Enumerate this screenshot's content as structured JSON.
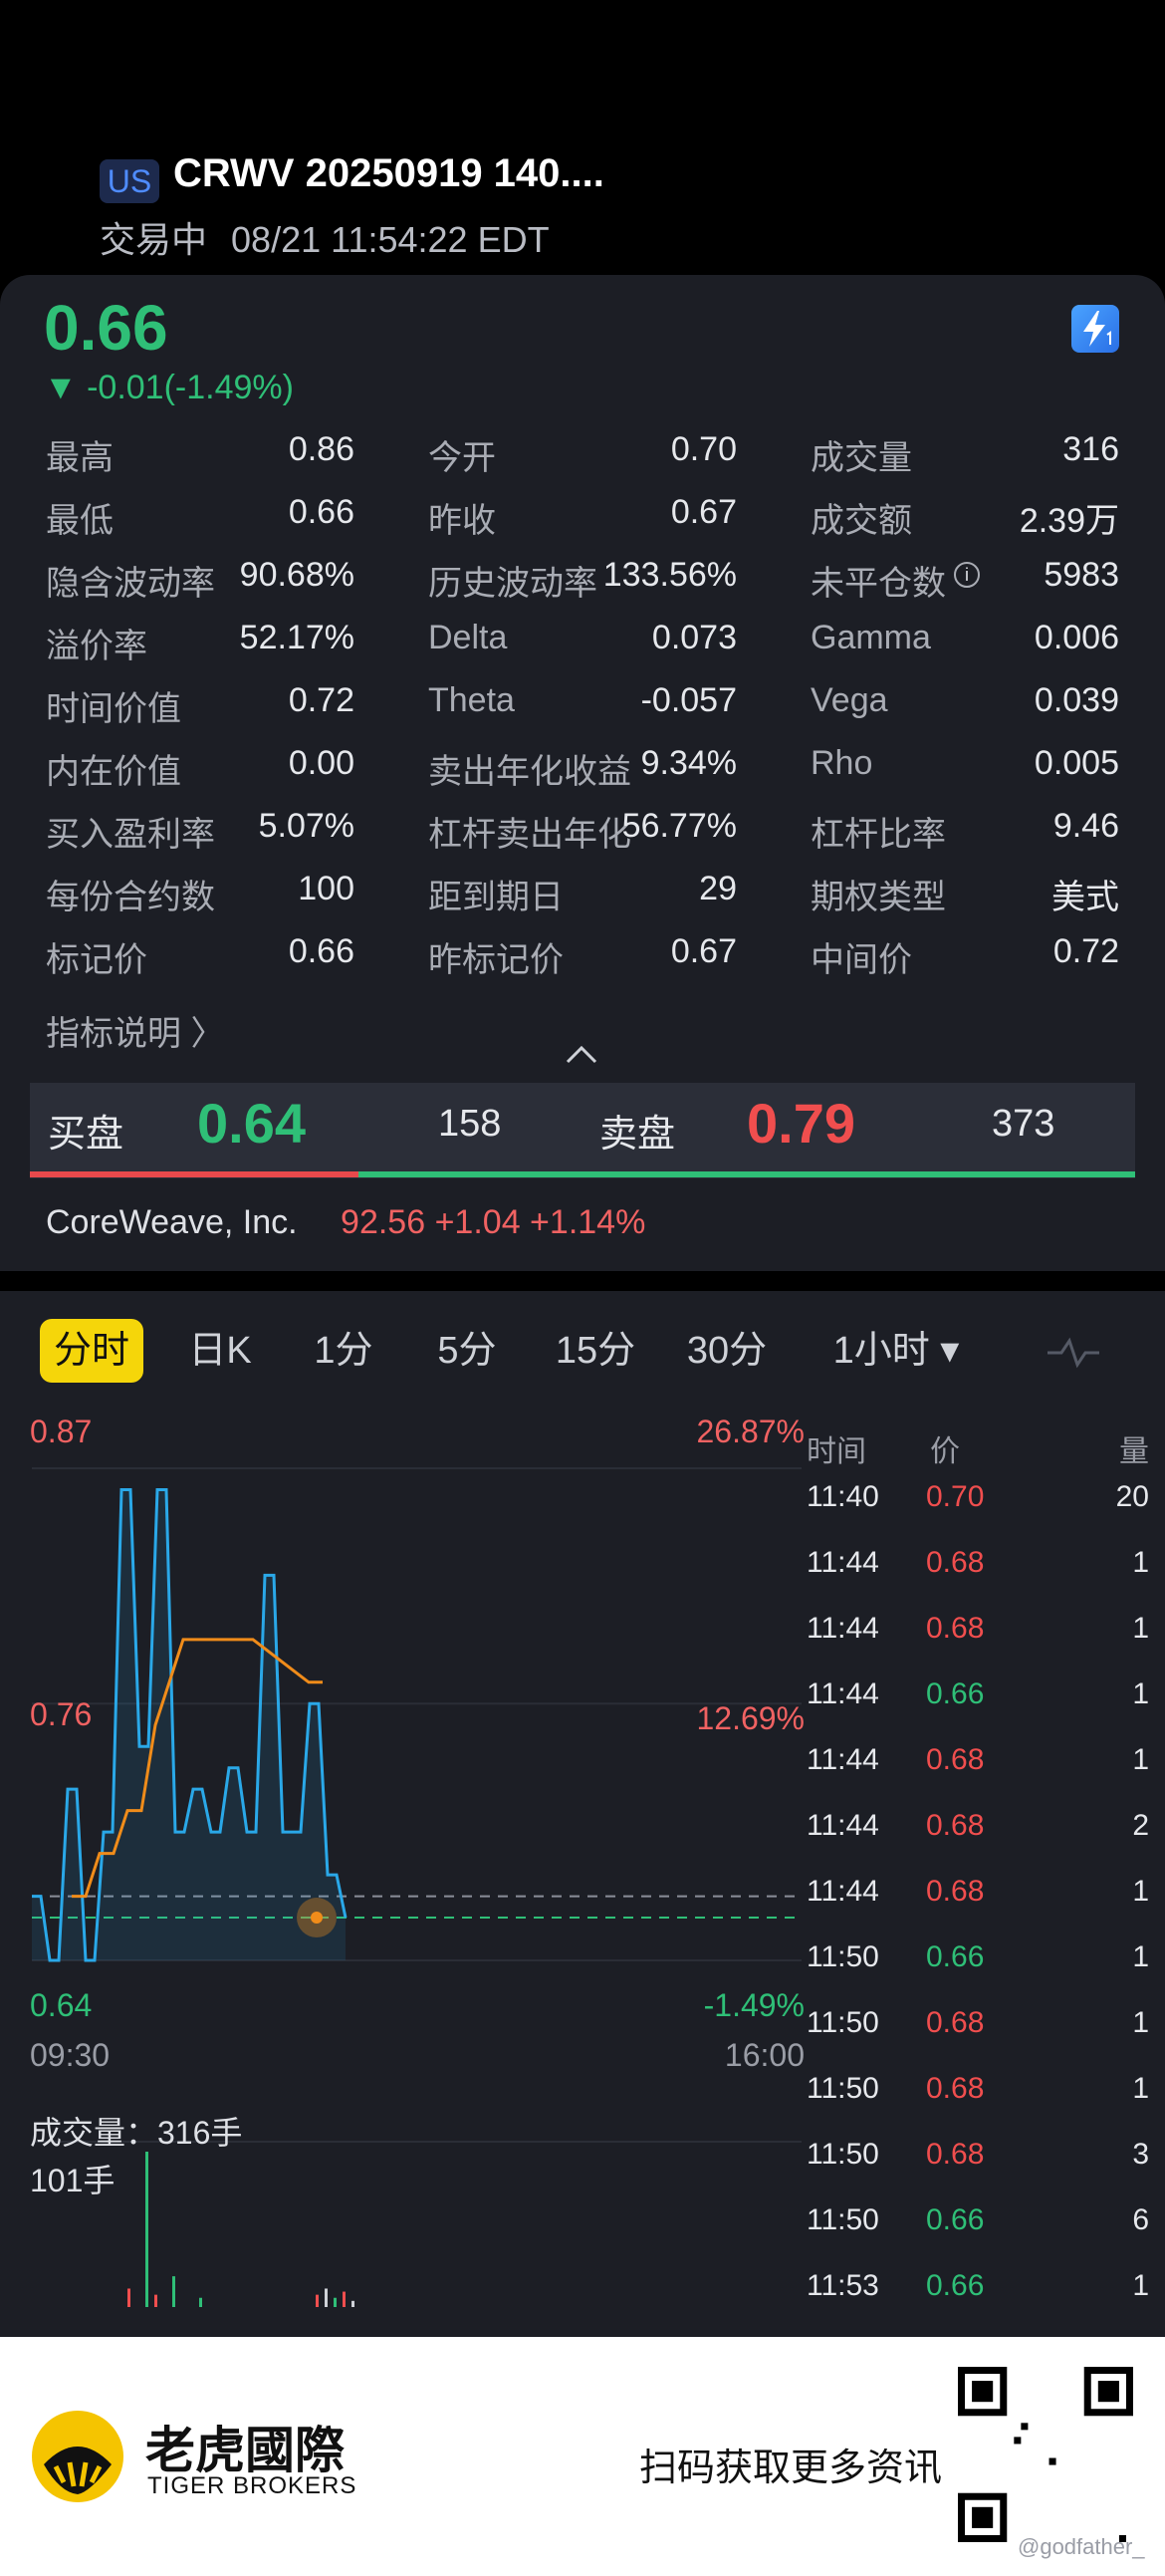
{
  "header": {
    "market_badge": "US",
    "title": "CRWV 20250919 140....",
    "status": "交易中",
    "datetime": "08/21 11:54:22 EDT"
  },
  "quote": {
    "price": "0.66",
    "change": "▼ -0.01(-1.49%)",
    "stats": [
      {
        "label": "最高",
        "value": "0.86"
      },
      {
        "label": "今开",
        "value": "0.70"
      },
      {
        "label": "成交量",
        "value": "316"
      },
      {
        "label": "最低",
        "value": "0.66"
      },
      {
        "label": "昨收",
        "value": "0.67"
      },
      {
        "label": "成交额",
        "value": "2.39万"
      },
      {
        "label": "隐含波动率",
        "value": "90.68%"
      },
      {
        "label": "历史波动率",
        "value": "133.56%"
      },
      {
        "label": "未平仓数",
        "value": "5983"
      },
      {
        "label": "溢价率",
        "value": "52.17%"
      },
      {
        "label": "Delta",
        "value": "0.073"
      },
      {
        "label": "Gamma",
        "value": "0.006"
      },
      {
        "label": "时间价值",
        "value": "0.72"
      },
      {
        "label": "Theta",
        "value": "-0.057"
      },
      {
        "label": "Vega",
        "value": "0.039"
      },
      {
        "label": "内在价值",
        "value": "0.00"
      },
      {
        "label": "卖出年化收益",
        "value": "9.34%"
      },
      {
        "label": "Rho",
        "value": "0.005"
      },
      {
        "label": "买入盈利率",
        "value": "5.07%"
      },
      {
        "label": "杠杆卖出年化",
        "value": "56.77%"
      },
      {
        "label": "杠杆比率",
        "value": "9.46"
      },
      {
        "label": "每份合约数",
        "value": "100"
      },
      {
        "label": "距到期日",
        "value": "29"
      },
      {
        "label": "期权类型",
        "value": "美式"
      },
      {
        "label": "标记价",
        "value": "0.66"
      },
      {
        "label": "昨标记价",
        "value": "0.67"
      },
      {
        "label": "中间价",
        "value": "0.72"
      }
    ],
    "info_glyph": "i",
    "indicator_link": "指标说明 〉",
    "bid_label": "买盘",
    "bid_price": "0.64",
    "bid_size": "158",
    "ask_label": "卖盘",
    "ask_price": "0.79",
    "ask_size": "373",
    "bid_ask_ratio": 0.3,
    "underlying_name": "CoreWeave, Inc.",
    "underlying_quote": "92.56 +1.04 +1.14%"
  },
  "chart": {
    "tabs": [
      "分时",
      "日K",
      "1分",
      "5分",
      "15分",
      "30分",
      "1小时 ▾"
    ],
    "active_tab": "分时",
    "y_top_price": "0.87",
    "y_mid_price": "0.76",
    "y_bottom_price": "0.64",
    "y_top_pct": "26.87%",
    "y_mid_pct": "12.69%",
    "y_bottom_pct": "-1.49%",
    "x_start": "09:30",
    "x_end": "16:00",
    "volume_title": "成交量：316手",
    "volume_max": "101手",
    "colors": {
      "price_line": "#2aa8e8",
      "avg_line": "#f08c1a",
      "up": "#f04e4e",
      "down": "#2fbf77"
    }
  },
  "chart_data": {
    "type": "line",
    "x_range": [
      "09:30",
      "16:00"
    ],
    "ylim": [
      0.64,
      0.87
    ],
    "series": [],
    "price": [
      0.67,
      0.67,
      0.64,
      0.64,
      0.72,
      0.72,
      0.64,
      0.64,
      0.7,
      0.7,
      0.86,
      0.86,
      0.74,
      0.74,
      0.86,
      0.86,
      0.7,
      0.7,
      0.72,
      0.72,
      0.7,
      0.7,
      0.73,
      0.73,
      0.7,
      0.7,
      0.82,
      0.82,
      0.7,
      0.7,
      0.7,
      0.76,
      0.76,
      0.68,
      0.68,
      0.66
    ],
    "avg": [
      0.67,
      0.67,
      0.69,
      0.69,
      0.71,
      0.71,
      0.75,
      0.77,
      0.79,
      0.79,
      0.79,
      0.79,
      0.79,
      0.79,
      0.785,
      0.78,
      0.775,
      0.77,
      0.77
    ],
    "volume": [
      0,
      0,
      0,
      0,
      12,
      0,
      101,
      8,
      0,
      20,
      0,
      0,
      6,
      0,
      0,
      0,
      0,
      0,
      0,
      0,
      0,
      0,
      0,
      0,
      0,
      8,
      12,
      6,
      10,
      4
    ],
    "last_price": "0.66"
  },
  "trades": {
    "headers": [
      "时间",
      "价",
      "量"
    ],
    "rows": [
      {
        "time": "11:40",
        "price": "0.70",
        "dir": "up",
        "vol": "20"
      },
      {
        "time": "11:44",
        "price": "0.68",
        "dir": "up",
        "vol": "1"
      },
      {
        "time": "11:44",
        "price": "0.68",
        "dir": "up",
        "vol": "1"
      },
      {
        "time": "11:44",
        "price": "0.66",
        "dir": "down",
        "vol": "1"
      },
      {
        "time": "11:44",
        "price": "0.68",
        "dir": "up",
        "vol": "1"
      },
      {
        "time": "11:44",
        "price": "0.68",
        "dir": "up",
        "vol": "2"
      },
      {
        "time": "11:44",
        "price": "0.68",
        "dir": "up",
        "vol": "1"
      },
      {
        "time": "11:50",
        "price": "0.66",
        "dir": "down",
        "vol": "1"
      },
      {
        "time": "11:50",
        "price": "0.68",
        "dir": "up",
        "vol": "1"
      },
      {
        "time": "11:50",
        "price": "0.68",
        "dir": "up",
        "vol": "1"
      },
      {
        "time": "11:50",
        "price": "0.68",
        "dir": "up",
        "vol": "3"
      },
      {
        "time": "11:50",
        "price": "0.66",
        "dir": "down",
        "vol": "6"
      },
      {
        "time": "11:53",
        "price": "0.66",
        "dir": "down",
        "vol": "1"
      }
    ]
  },
  "footer": {
    "brand_cn": "老虎國際",
    "brand_en": "TIGER BROKERS",
    "scan_text": "扫码获取更多资讯",
    "watermark": "@godfather_"
  }
}
